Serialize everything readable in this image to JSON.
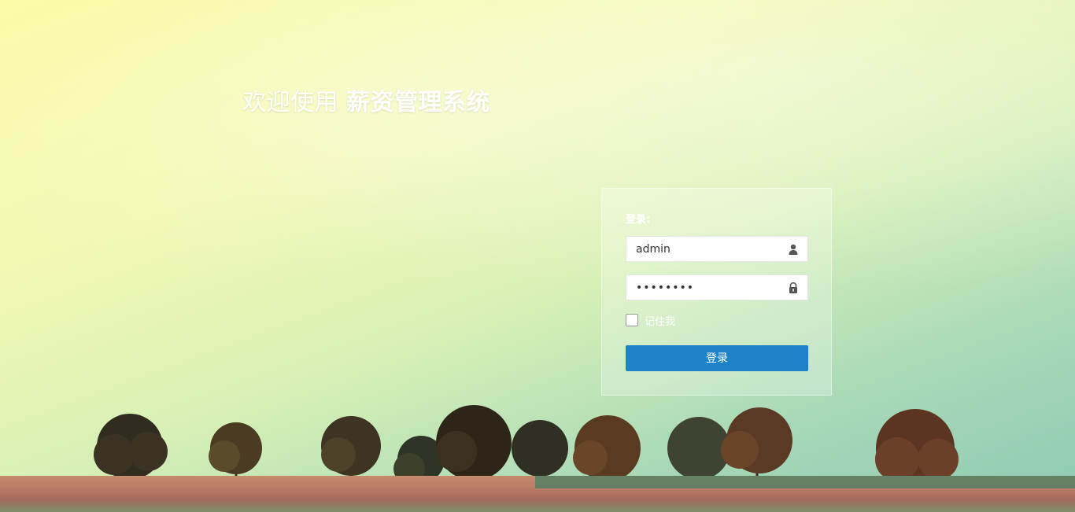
{
  "header": {
    "welcome_prefix": "欢迎使用",
    "system_name": "薪资管理系统"
  },
  "login": {
    "heading": "登录:",
    "username_value": "admin",
    "username_icon": "user-icon",
    "password_masked": "••••••••",
    "password_icon": "lock-icon",
    "remember_label": "记住我",
    "remember_checked": false,
    "submit_label": "登录"
  },
  "colors": {
    "button": "#1c83c9",
    "text_on_bg": "#ffffff"
  }
}
